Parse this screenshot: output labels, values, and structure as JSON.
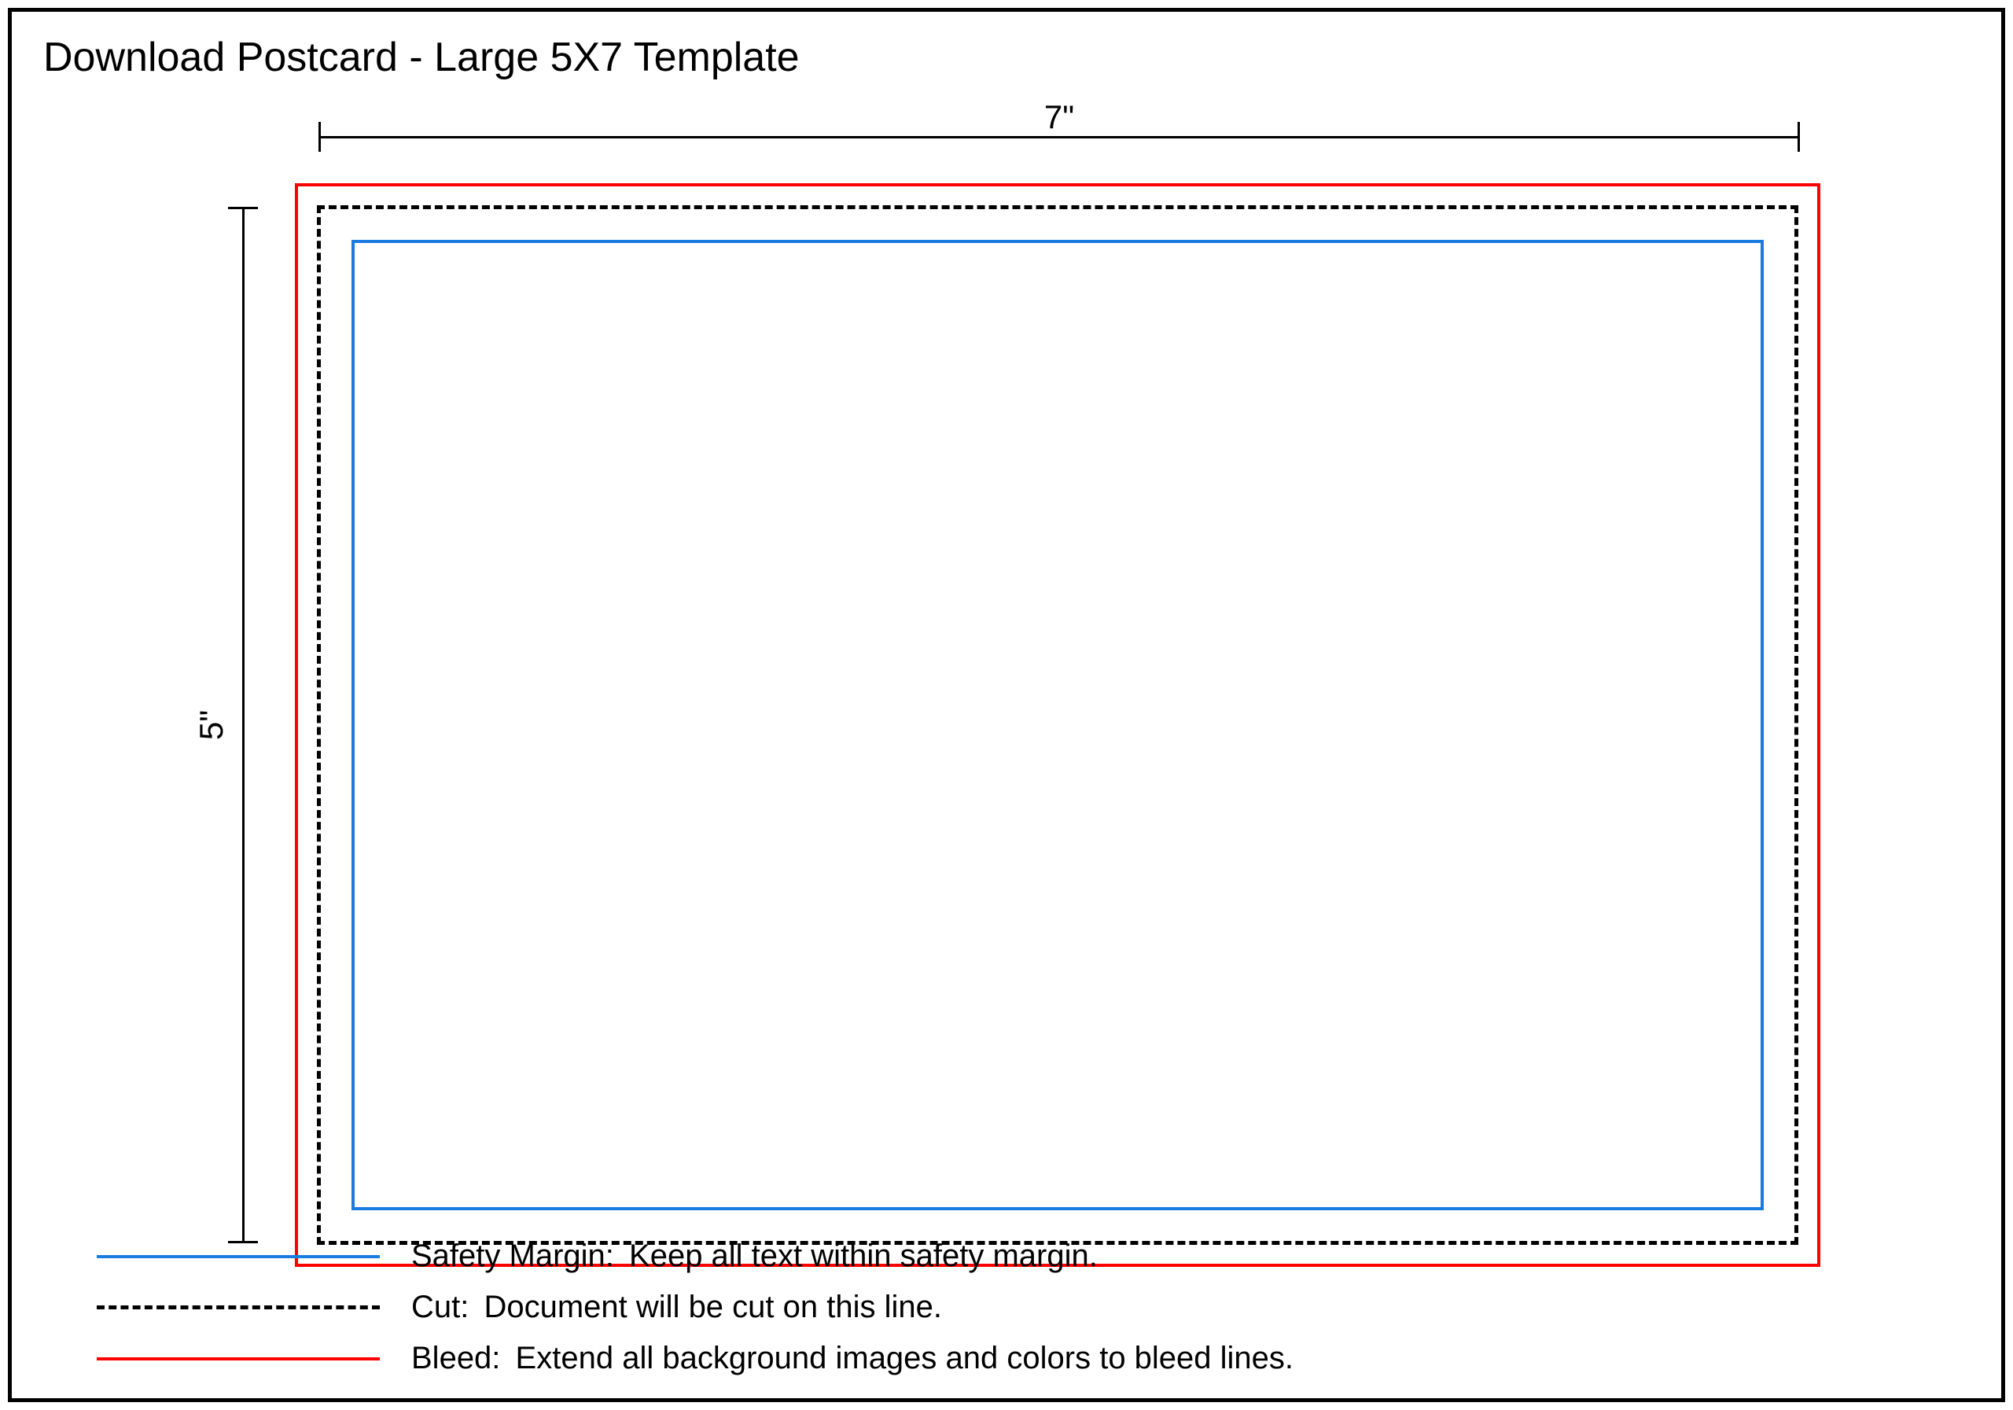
{
  "title": "Download Postcard - Large 5X7 Template",
  "dimensions": {
    "width_label": "7\"",
    "height_label": "5\""
  },
  "legend": {
    "safety": {
      "label": "Safety Margin:",
      "description": "Keep all text within safety margin.",
      "color": "#1a7be0"
    },
    "cut": {
      "label": "Cut:",
      "description": "Document will be cut on this line.",
      "color": "#000000"
    },
    "bleed": {
      "label": "Bleed:",
      "description": "Extend all background images and colors to bleed lines.",
      "color": "#ff0000"
    }
  }
}
